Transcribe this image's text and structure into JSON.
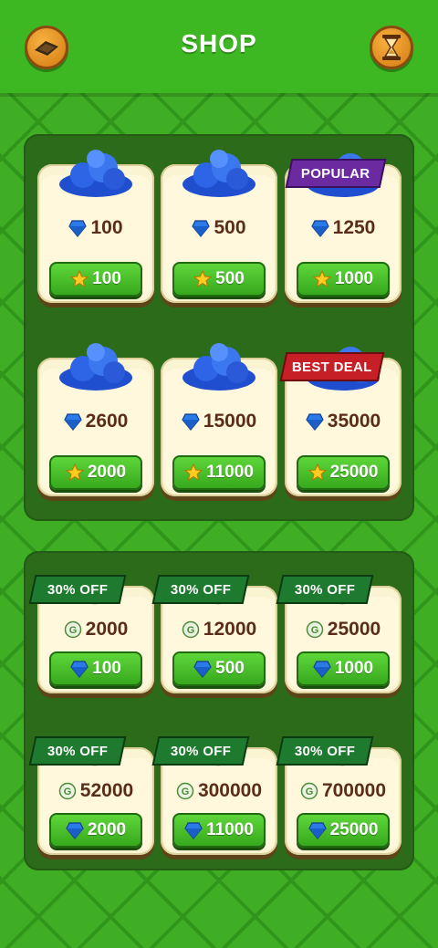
{
  "header": {
    "title": "SHOP",
    "left_icon": "map-icon",
    "right_icon": "hourglass-icon"
  },
  "colors": {
    "background": "#3fae24",
    "header": "#3db822",
    "panel": "#2b6b1a",
    "card": "#fbf4d3",
    "button": "#46c12a",
    "amount_text": "#5a2d1a",
    "ribbon_popular": "#6b2aa0",
    "ribbon_best_deal": "#c61f25",
    "ribbon_discount": "#1d7a2e"
  },
  "gem_packs": [
    {
      "amount": "100",
      "price": "100",
      "ribbon": ""
    },
    {
      "amount": "500",
      "price": "500",
      "ribbon": ""
    },
    {
      "amount": "1250",
      "price": "1000",
      "ribbon": "POPULAR"
    },
    {
      "amount": "2600",
      "price": "2000",
      "ribbon": ""
    },
    {
      "amount": "15000",
      "price": "11000",
      "ribbon": ""
    },
    {
      "amount": "35000",
      "price": "25000",
      "ribbon": "BEST DEAL"
    }
  ],
  "coin_packs": [
    {
      "amount": "2000",
      "price": "100",
      "ribbon": "30% OFF"
    },
    {
      "amount": "12000",
      "price": "500",
      "ribbon": "30% OFF"
    },
    {
      "amount": "25000",
      "price": "1000",
      "ribbon": "30% OFF"
    },
    {
      "amount": "52000",
      "price": "2000",
      "ribbon": "30% OFF"
    },
    {
      "amount": "300000",
      "price": "11000",
      "ribbon": "30% OFF"
    },
    {
      "amount": "700000",
      "price": "25000",
      "ribbon": "30% OFF"
    }
  ]
}
